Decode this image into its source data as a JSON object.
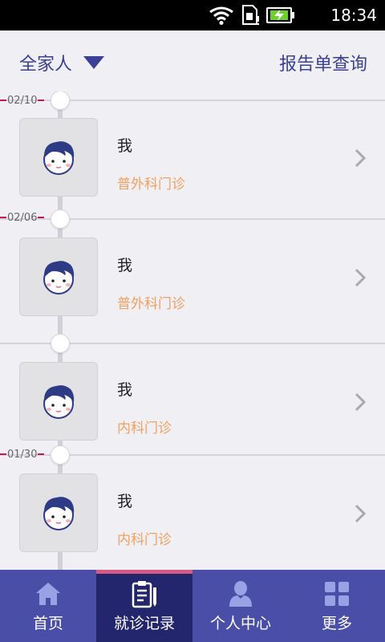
{
  "status_bar": {
    "time": "18:34"
  },
  "header": {
    "family_filter": "全家人",
    "report_link": "报告单查询"
  },
  "timeline": {
    "dates": [
      "02/10",
      "02/06",
      "01/30"
    ],
    "records": [
      {
        "name": "我",
        "department": "普外科门诊"
      },
      {
        "name": "我",
        "department": "普外科门诊"
      },
      {
        "name": "我",
        "department": "内科门诊"
      },
      {
        "name": "我",
        "department": "内科门诊"
      }
    ]
  },
  "bottom_nav": {
    "items": [
      {
        "label": "首页",
        "icon": "home-icon"
      },
      {
        "label": "就诊记录",
        "icon": "clipboard-icon",
        "active": true
      },
      {
        "label": "个人中心",
        "icon": "person-icon"
      },
      {
        "label": "更多",
        "icon": "grid-icon"
      }
    ]
  },
  "colors": {
    "brand": "#3b3f95",
    "nav_bg": "#4a4ea6",
    "nav_active": "#23266d",
    "accent": "#d45a83",
    "department": "#f0a060"
  }
}
